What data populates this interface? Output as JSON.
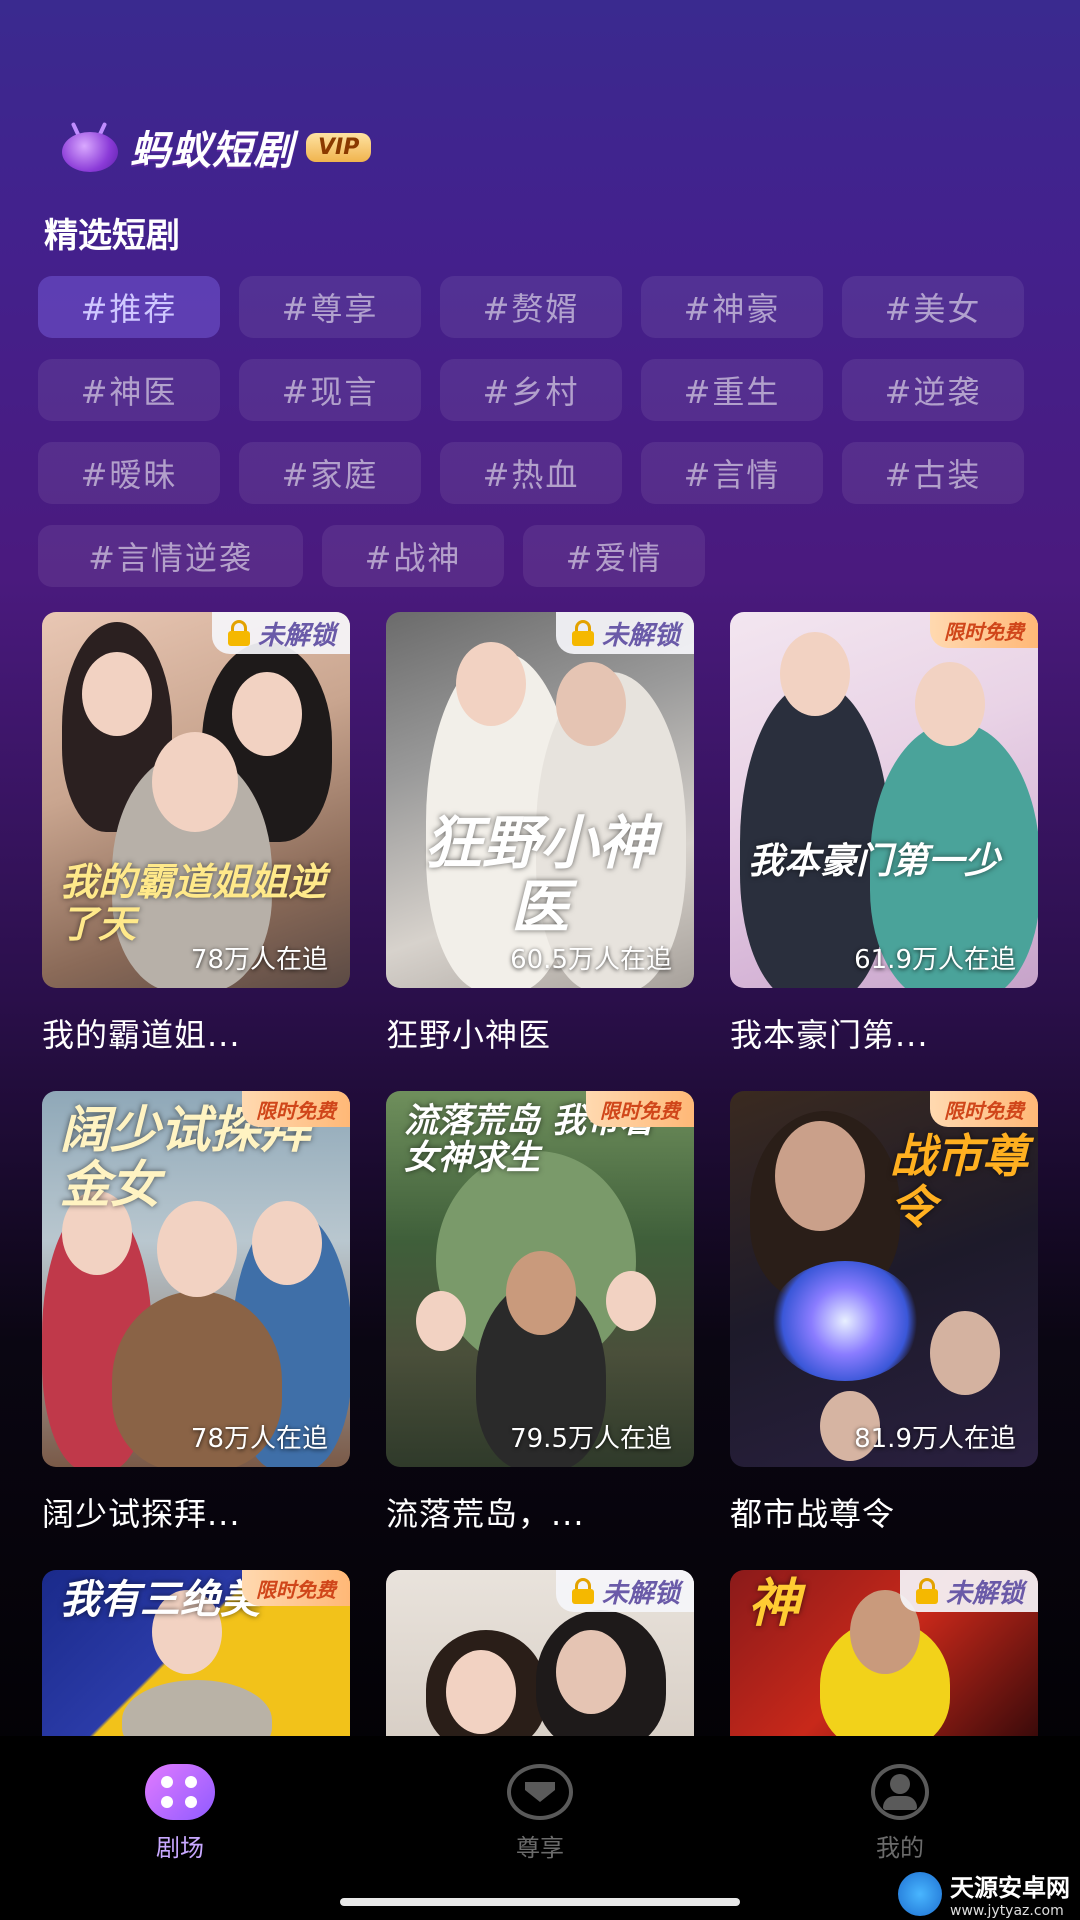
{
  "header": {
    "app_name": "蚂蚁短剧",
    "vip": "VIP"
  },
  "section_title": "精选短剧",
  "tags": [
    "#推荐",
    "#尊享",
    "#赘婿",
    "#神豪",
    "#美女",
    "#神医",
    "#现言",
    "#乡村",
    "#重生",
    "#逆袭",
    "#暧昧",
    "#家庭",
    "#热血",
    "#言情",
    "#古装",
    "#言情逆袭",
    "#战神",
    "#爱情"
  ],
  "active_tag": "#推荐",
  "dramas": [
    {
      "title": "我的霸道姐...",
      "followers": "78万人在追",
      "badge": "未解锁",
      "badge_type": "locked",
      "art": "我的霸道姐姐逆了天"
    },
    {
      "title": "狂野小神医",
      "followers": "60.5万人在追",
      "badge": "未解锁",
      "badge_type": "locked",
      "art": "狂野小神医"
    },
    {
      "title": "我本豪门第...",
      "followers": "61.9万人在追",
      "badge": "限时免费",
      "badge_type": "free",
      "art": "我本豪门第一少"
    },
    {
      "title": "阔少试探拜...",
      "followers": "78万人在追",
      "badge": "限时免费",
      "badge_type": "free",
      "art": "阔少试探拜金女"
    },
    {
      "title": "流落荒岛，...",
      "followers": "79.5万人在追",
      "badge": "限时免费",
      "badge_type": "free",
      "art": "流落荒岛 我带着女神求生"
    },
    {
      "title": "都市战尊令",
      "followers": "81.9万人在追",
      "badge": "限时免费",
      "badge_type": "free",
      "art": "战市尊令"
    },
    {
      "title": "",
      "followers": "",
      "badge": "限时免费",
      "badge_type": "free",
      "art": "我有三绝美"
    },
    {
      "title": "",
      "followers": "",
      "badge": "未解锁",
      "badge_type": "locked",
      "art": ""
    },
    {
      "title": "",
      "followers": "",
      "badge": "未解锁",
      "badge_type": "locked",
      "art": "神"
    }
  ],
  "tabbar": [
    {
      "label": "剧场",
      "icon": "theater-icon",
      "active": true
    },
    {
      "label": "尊享",
      "icon": "diamond-icon",
      "active": false
    },
    {
      "label": "我的",
      "icon": "profile-icon",
      "active": false
    }
  ],
  "watermark": {
    "name": "天源安卓网",
    "url": "www.jytyaz.com"
  },
  "colors": {
    "accent": "#c8a8ff",
    "free_badge_text": "#d0461a",
    "lock_gold": "#f5b800"
  }
}
